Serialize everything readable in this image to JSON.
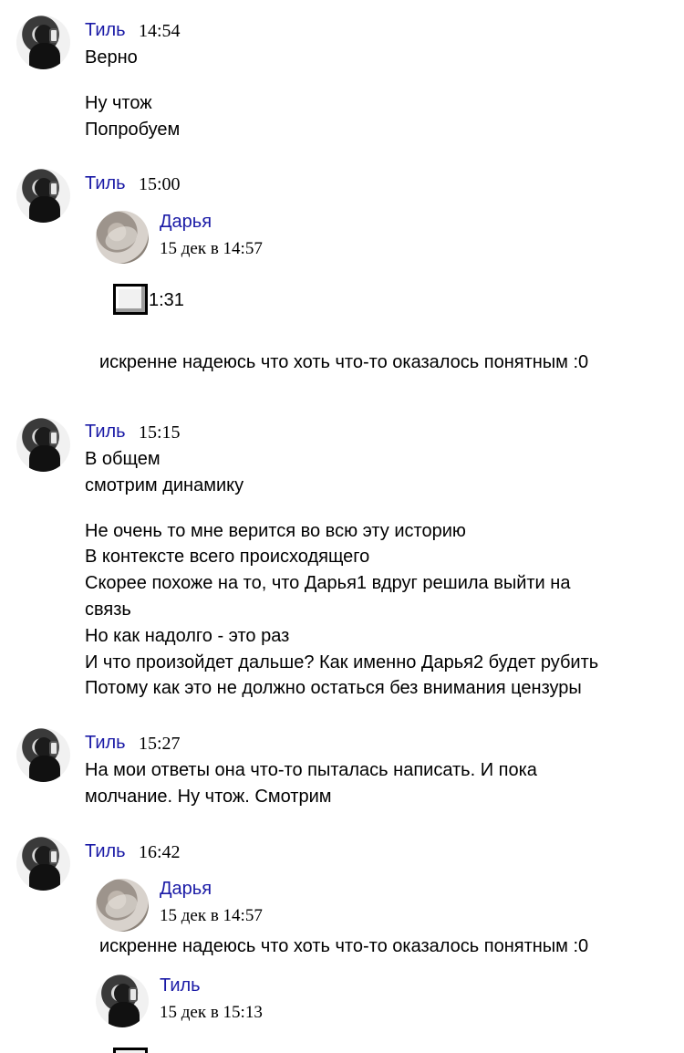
{
  "messages": [
    {
      "author": "Тиль",
      "time": "14:54",
      "lines": [
        "Верно",
        "",
        "Ну чтож",
        "Попробуем"
      ]
    },
    {
      "author": "Тиль",
      "time": "15:00",
      "forward": {
        "author": "Дарья",
        "date": "15 дек в 14:57",
        "audio_duration": "1:31",
        "text": "искренне надеюсь что хоть что-то оказалось понятным :0"
      }
    },
    {
      "author": "Тиль",
      "time": "15:15",
      "lines": [
        "В общем",
        "смотрим динамику",
        "",
        "Не очень то мне верится во всю эту историю",
        "В контексте всего происходящего",
        "Скорее похоже на то, что Дарья1 вдруг решила выйти на",
        "связь",
        "Но как надолго - это раз",
        "И что произойдет дальше? Как именно Дарья2 будет рубить",
        "Потому как это не должно остаться без внимания цензуры"
      ]
    },
    {
      "author": "Тиль",
      "time": "15:27",
      "lines": [
        "На мои ответы она что-то пыталась написать. И пока",
        "молчание. Ну чтож. Смотрим"
      ]
    },
    {
      "author": "Тиль",
      "time": "16:42",
      "forward": {
        "author": "Дарья",
        "date": "15 дек в 14:57",
        "text": "искренне надеюсь что хоть что-то оказалось понятным :0"
      },
      "forward2": {
        "author": "Тиль",
        "date": "15 дек в 15:13"
      }
    }
  ]
}
